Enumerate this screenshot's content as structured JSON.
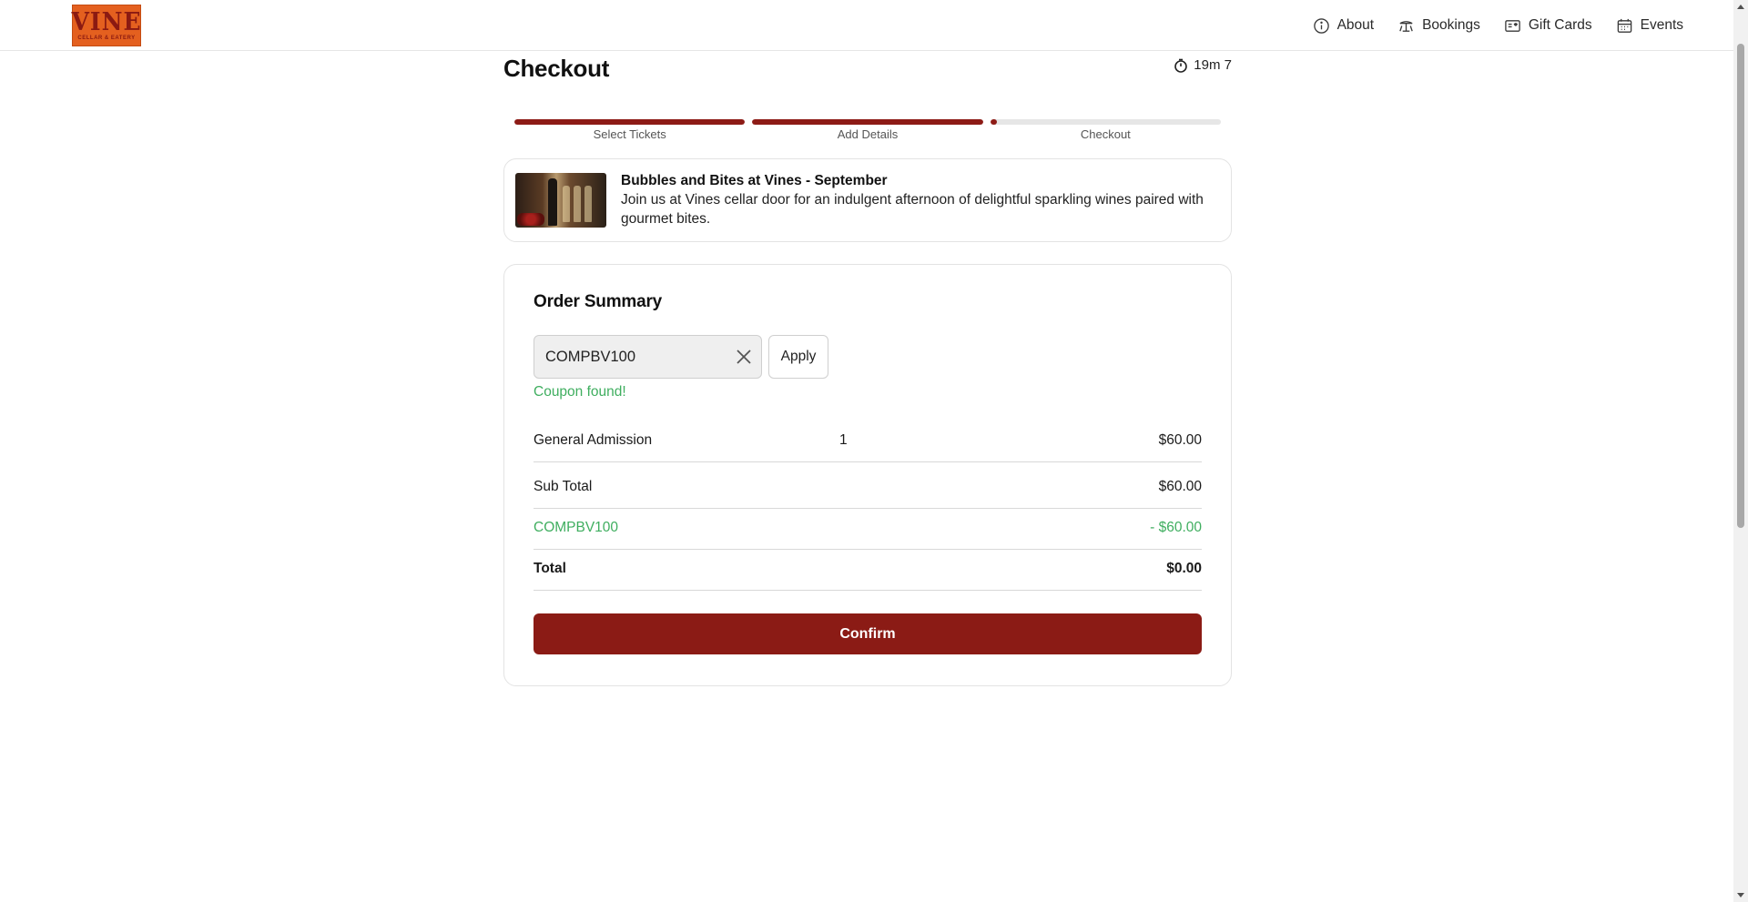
{
  "header": {
    "logo_text": "VINE",
    "logo_subtitle": "CELLAR & EATERY",
    "nav": [
      {
        "label": "About",
        "icon": "info-icon"
      },
      {
        "label": "Bookings",
        "icon": "table-icon"
      },
      {
        "label": "Gift Cards",
        "icon": "gift-card-icon"
      },
      {
        "label": "Events",
        "icon": "calendar-icon"
      }
    ]
  },
  "page": {
    "title": "Checkout",
    "timer": "19m 7"
  },
  "steps": [
    {
      "label": "Select Tickets",
      "progress": 1.0
    },
    {
      "label": "Add Details",
      "progress": 1.0
    },
    {
      "label": "Checkout",
      "progress": 0.03
    }
  ],
  "event": {
    "title": "Bubbles and Bites at Vines - September",
    "description": "Join us at Vines cellar door for an indulgent afternoon of delightful sparkling wines paired with gourmet bites."
  },
  "order_summary": {
    "title": "Order Summary",
    "coupon_value": "COMPBV100",
    "apply_label": "Apply",
    "coupon_message": "Coupon found!",
    "line_item": {
      "name": "General Admission",
      "qty": "1",
      "price": "$60.00"
    },
    "subtotal": {
      "label": "Sub Total",
      "value": "$60.00"
    },
    "discount": {
      "label": "COMPBV100",
      "value": "- $60.00"
    },
    "total": {
      "label": "Total",
      "value": "$0.00"
    },
    "confirm_label": "Confirm"
  },
  "colors": {
    "brand": "#8b1b15",
    "success": "#3fae5f",
    "logo_bg": "#e4601f"
  }
}
